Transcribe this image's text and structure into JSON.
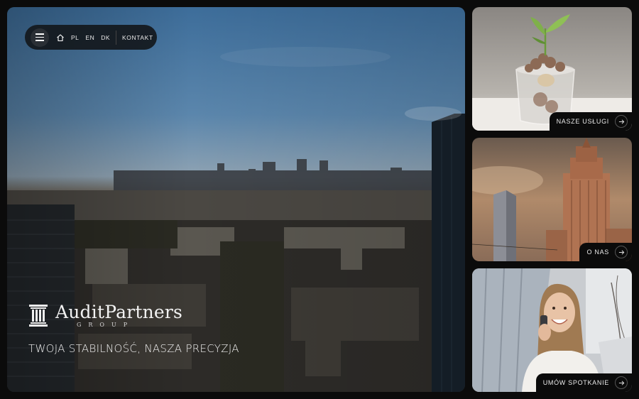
{
  "nav": {
    "languages": [
      "PL",
      "EN",
      "DK"
    ],
    "contact_label": "KONTAKT"
  },
  "brand": {
    "name": "AuditPartners",
    "sub": "GROUP",
    "tagline": "TWOJA STABILNOŚĆ, NASZA PRECYZJA"
  },
  "cards": [
    {
      "label": "NASZE USŁUGI",
      "icon": "arrow-right-icon"
    },
    {
      "label": "O NAS",
      "icon": "arrow-right-icon"
    },
    {
      "label": "UMÓW SPOTKANIE",
      "icon": "arrow-right-icon"
    }
  ],
  "colors": {
    "background": "#0b0b0b",
    "nav_pill": "#14181c",
    "text": "#ffffff"
  }
}
